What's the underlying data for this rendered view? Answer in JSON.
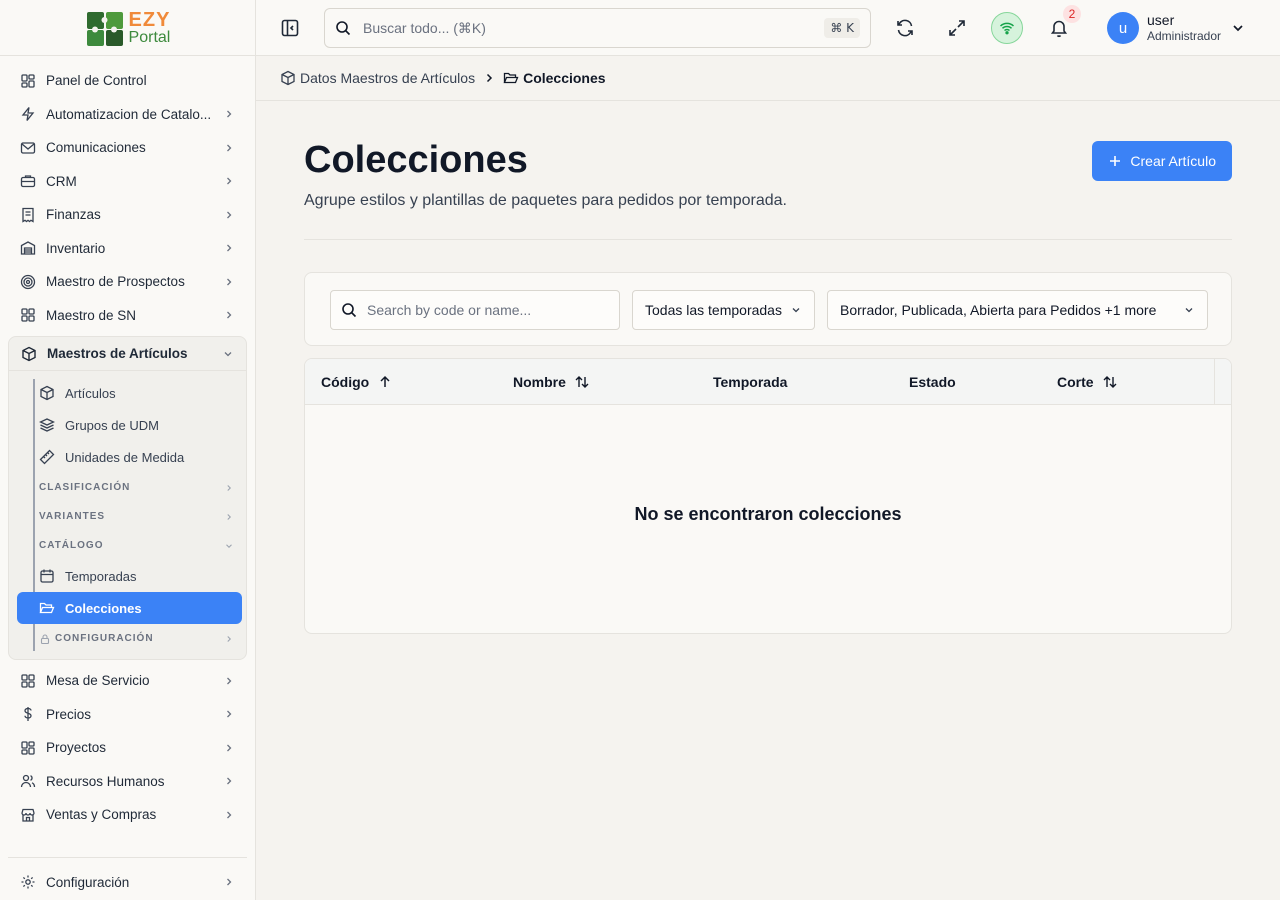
{
  "brand": {
    "line1": "EZY",
    "line2": "Portal"
  },
  "sidebar": {
    "items_top": [
      {
        "label": "Panel de Control",
        "icon": "dashboard-icon",
        "chevron": false
      },
      {
        "label": "Automatizacion de Catalo...",
        "icon": "zap-icon",
        "chevron": true
      },
      {
        "label": "Comunicaciones",
        "icon": "mail-icon",
        "chevron": true
      },
      {
        "label": "CRM",
        "icon": "briefcase-icon",
        "chevron": true
      },
      {
        "label": "Finanzas",
        "icon": "receipt-icon",
        "chevron": true
      },
      {
        "label": "Inventario",
        "icon": "warehouse-icon",
        "chevron": true
      },
      {
        "label": "Maestro de Prospectos",
        "icon": "target-icon",
        "chevron": true
      },
      {
        "label": "Maestro de SN",
        "icon": "grid-icon",
        "chevron": true
      }
    ],
    "group": {
      "label": "Maestros de Artículos",
      "children": [
        {
          "label": "Artículos"
        },
        {
          "label": "Grupos de UDM"
        },
        {
          "label": "Unidades de Medida"
        }
      ],
      "sections": {
        "clasificacion": "CLASIFICACIÓN",
        "variantes": "VARIANTES",
        "catalogo": "CATÁLOGO",
        "configuracion": "CONFIGURACIÓN"
      },
      "catalog_children": [
        {
          "label": "Temporadas"
        },
        {
          "label": "Colecciones"
        }
      ]
    },
    "items_bottom": [
      {
        "label": "Mesa de Servicio"
      },
      {
        "label": "Precios"
      },
      {
        "label": "Proyectos"
      },
      {
        "label": "Recursos Humanos"
      },
      {
        "label": "Ventas y Compras"
      }
    ],
    "settings_label": "Configuración"
  },
  "topbar": {
    "search_placeholder": "Buscar todo... (⌘K)",
    "shortcut": "⌘ K",
    "notifications_count": "2",
    "user_initial": "u",
    "user_name": "user",
    "user_role": "Administrador"
  },
  "breadcrumb": {
    "parent": "Datos Maestros de Artículos",
    "current": "Colecciones"
  },
  "page": {
    "title": "Colecciones",
    "subtitle": "Agrupe estilos y plantillas de paquetes para pedidos por temporada.",
    "create_label": "Crear Artículo"
  },
  "filters": {
    "search_placeholder": "Search by code or name...",
    "season_value": "Todas las temporadas",
    "status_value": "Borrador, Publicada, Abierta para Pedidos +1 more"
  },
  "table": {
    "columns": [
      "Código",
      "Nombre",
      "Temporada",
      "Estado",
      "Corte"
    ],
    "empty_message": "No se encontraron colecciones"
  },
  "colors": {
    "accent": "#3b82f6",
    "background": "#f5f3ef",
    "brand_orange": "#f08a3a",
    "brand_green": "#3d8a3d"
  }
}
